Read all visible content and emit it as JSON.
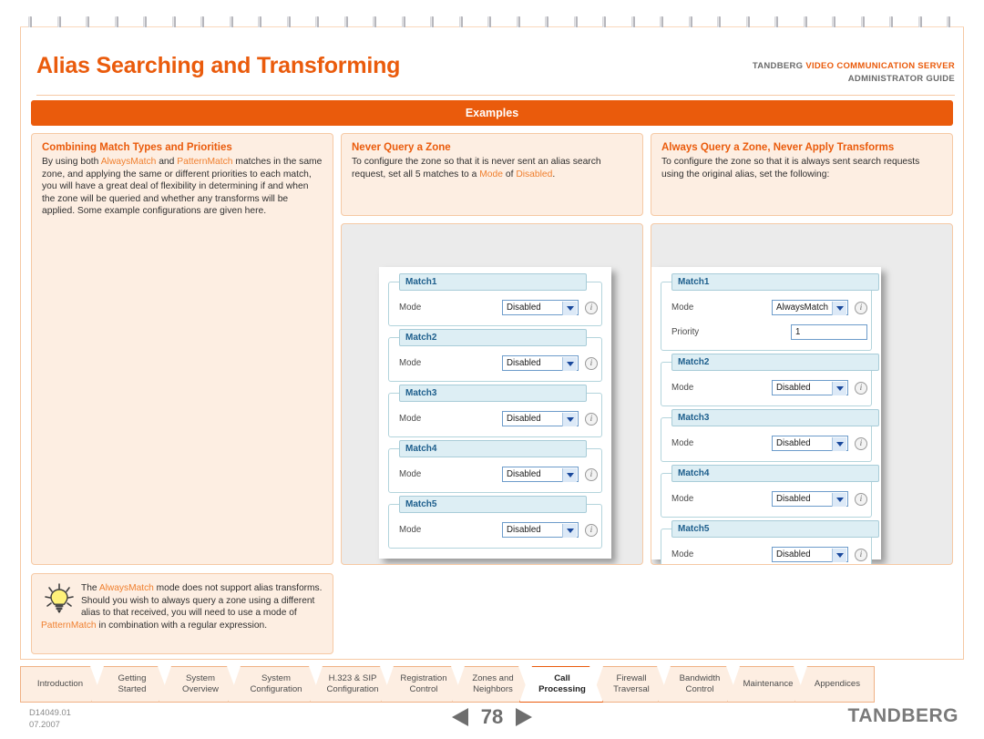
{
  "header": {
    "title": "Alias Searching and Transforming",
    "brand_prefix": "TANDBERG",
    "brand_product": "VIDEO COMMUNICATION SERVER",
    "brand_guide": "ADMINISTRATOR GUIDE"
  },
  "banner": {
    "label": "Examples"
  },
  "columns": {
    "left": {
      "intro": {
        "title": "Combining Match Types and Priorities",
        "body_parts": [
          {
            "text": "By using both ",
            "highlight": false
          },
          {
            "text": "AlwaysMatch",
            "highlight": true
          },
          {
            "text": " and ",
            "highlight": false
          },
          {
            "text": "PatternMatch",
            "highlight": true
          },
          {
            "text": " matches in the same zone, and applying the same or different priorities to each match, you will have a great deal of flexibility in determining if and when the zone will be queried and whether any transforms will be applied.  Some example configurations are given here.",
            "highlight": false
          }
        ]
      },
      "tip": {
        "icon": "lightbulb-icon",
        "body_parts": [
          {
            "text": "The ",
            "highlight": false
          },
          {
            "text": "AlwaysMatch",
            "highlight": true
          },
          {
            "text": " mode does not support alias transforms.  Should you wish to always query a zone using a different alias to that received, you will need to use a mode of ",
            "highlight": false
          },
          {
            "text": "PatternMatch",
            "highlight": true
          },
          {
            "text": " in combination with a regular expression.",
            "highlight": false
          }
        ]
      }
    },
    "middle": {
      "intro": {
        "title": "Never Query a Zone",
        "body_parts": [
          {
            "text": "To configure the zone so that it is never sent an alias search request, set all 5 matches to a ",
            "highlight": false
          },
          {
            "text": "Mode",
            "highlight": true
          },
          {
            "text": " of ",
            "highlight": false
          },
          {
            "text": "Disabled",
            "highlight": true
          },
          {
            "text": ".",
            "highlight": false
          }
        ]
      },
      "screenshot": {
        "fieldsets": [
          {
            "legend": "Match1",
            "rows": [
              {
                "label": "Mode",
                "control": "select",
                "value": "Disabled",
                "info": true
              }
            ]
          },
          {
            "legend": "Match2",
            "rows": [
              {
                "label": "Mode",
                "control": "select",
                "value": "Disabled",
                "info": true
              }
            ]
          },
          {
            "legend": "Match3",
            "rows": [
              {
                "label": "Mode",
                "control": "select",
                "value": "Disabled",
                "info": true
              }
            ]
          },
          {
            "legend": "Match4",
            "rows": [
              {
                "label": "Mode",
                "control": "select",
                "value": "Disabled",
                "info": true
              }
            ]
          },
          {
            "legend": "Match5",
            "rows": [
              {
                "label": "Mode",
                "control": "select",
                "value": "Disabled",
                "info": true
              }
            ]
          }
        ]
      }
    },
    "right": {
      "intro": {
        "title": "Always Query a Zone, Never Apply Transforms",
        "body_parts": [
          {
            "text": "To configure the zone so that it is always sent search requests using the original alias, set the following:",
            "highlight": false
          }
        ]
      },
      "screenshot": {
        "fieldsets": [
          {
            "legend": "Match1",
            "rows": [
              {
                "label": "Mode",
                "control": "select",
                "value": "AlwaysMatch",
                "info": true
              },
              {
                "label": "Priority",
                "control": "text",
                "value": "1",
                "info": false
              }
            ]
          },
          {
            "legend": "Match2",
            "rows": [
              {
                "label": "Mode",
                "control": "select",
                "value": "Disabled",
                "info": true
              }
            ]
          },
          {
            "legend": "Match3",
            "rows": [
              {
                "label": "Mode",
                "control": "select",
                "value": "Disabled",
                "info": true
              }
            ]
          },
          {
            "legend": "Match4",
            "rows": [
              {
                "label": "Mode",
                "control": "select",
                "value": "Disabled",
                "info": true
              }
            ]
          },
          {
            "legend": "Match5",
            "rows": [
              {
                "label": "Mode",
                "control": "select",
                "value": "Disabled",
                "info": true
              }
            ]
          }
        ]
      }
    }
  },
  "nav_tabs": [
    {
      "label": "Introduction",
      "lines": [
        "Introduction"
      ],
      "active": false
    },
    {
      "label": "Getting Started",
      "lines": [
        "Getting",
        "Started"
      ],
      "active": false
    },
    {
      "label": "System Overview",
      "lines": [
        "System",
        "Overview"
      ],
      "active": false
    },
    {
      "label": "System Configuration",
      "lines": [
        "System",
        "Configuration"
      ],
      "active": false
    },
    {
      "label": "H.323 & SIP Configuration",
      "lines": [
        "H.323 & SIP",
        "Configuration"
      ],
      "active": false
    },
    {
      "label": "Registration Control",
      "lines": [
        "Registration",
        "Control"
      ],
      "active": false
    },
    {
      "label": "Zones and Neighbors",
      "lines": [
        "Zones and",
        "Neighbors"
      ],
      "active": false
    },
    {
      "label": "Call Processing",
      "lines": [
        "Call",
        "Processing"
      ],
      "active": true
    },
    {
      "label": "Firewall Traversal",
      "lines": [
        "Firewall",
        "Traversal"
      ],
      "active": false
    },
    {
      "label": "Bandwidth Control",
      "lines": [
        "Bandwidth",
        "Control"
      ],
      "active": false
    },
    {
      "label": "Maintenance",
      "lines": [
        "Maintenance"
      ],
      "active": false
    },
    {
      "label": "Appendices",
      "lines": [
        "Appendices"
      ],
      "active": false
    }
  ],
  "footer": {
    "doc_number": "D14049.01",
    "doc_date": "07.2007",
    "page_number": "78",
    "prev_label": "previous-page",
    "next_label": "next-page",
    "logo": "TANDBERG"
  },
  "colors": {
    "accent_orange": "#ea5b0c",
    "light_orange_bg": "#fdeee2",
    "border_orange": "#f6c9a4",
    "highlight_text": "#f08030",
    "panel_gray": "#ebebeb",
    "fieldset_blue": "#ddeef4",
    "legend_text_blue": "#1d5e8c"
  }
}
